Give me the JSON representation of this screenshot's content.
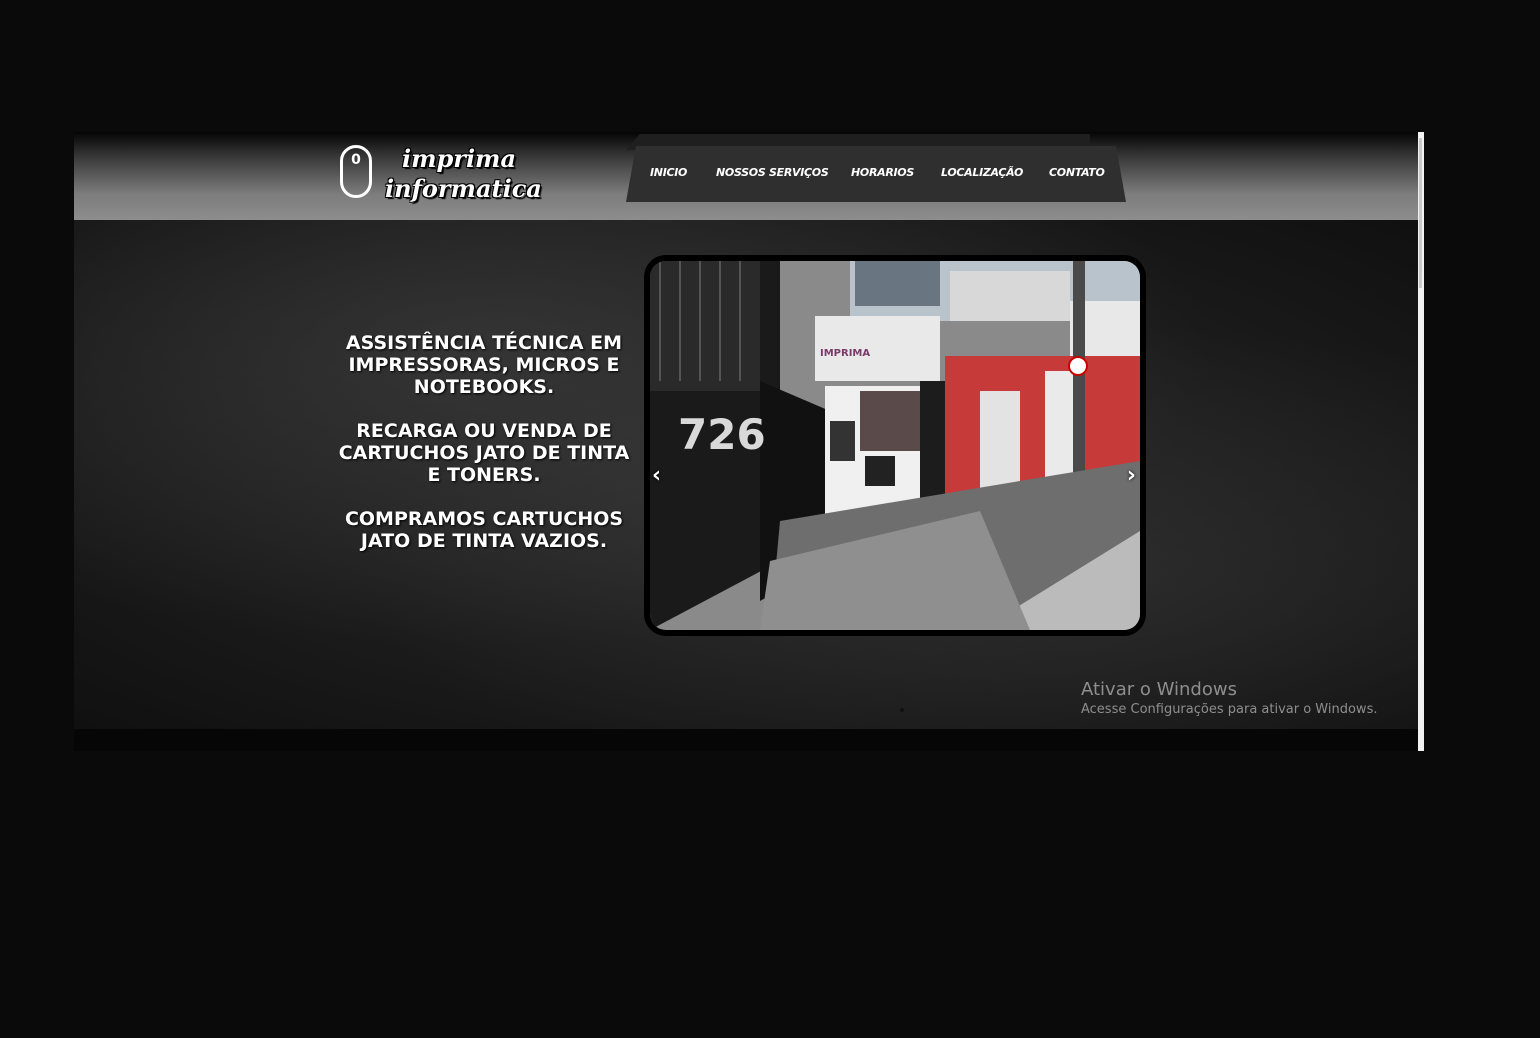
{
  "logo": {
    "line1": "imprima",
    "line2": "informatica",
    "mouse_glyph": "0"
  },
  "nav": {
    "items": [
      {
        "label": "INICIO"
      },
      {
        "label": "NOSSOS SERVIÇOS"
      },
      {
        "label": "HORARIOS"
      },
      {
        "label": "LOCALIZAÇÃO"
      },
      {
        "label": "CONTATO"
      }
    ]
  },
  "promo": {
    "paragraph1": "ASSISTÊNCIA TÉCNICA EM IMPRESSORAS, MICROS E NOTEBOOKS.",
    "paragraph2": "RECARGA OU VENDA DE CARTUCHOS JATO DE TINTA E TONERS.",
    "paragraph3": "COMPRAMOS CARTUCHOS JATO DE TINTA VAZIOS."
  },
  "carousel": {
    "storefront_number": "726",
    "sign_text": "IMPRIMA",
    "prev_icon": "chevron-left-icon",
    "next_icon": "chevron-right-icon",
    "prev_glyph": "‹",
    "next_glyph": "›"
  },
  "activation_watermark": {
    "title": "Ativar o Windows",
    "subtitle": "Acesse Configurações para ativar o Windows."
  },
  "colors": {
    "page_background": "#0a0a0a",
    "nav_background": "#2f2f2f",
    "storefront_red": "#c63a3a"
  }
}
